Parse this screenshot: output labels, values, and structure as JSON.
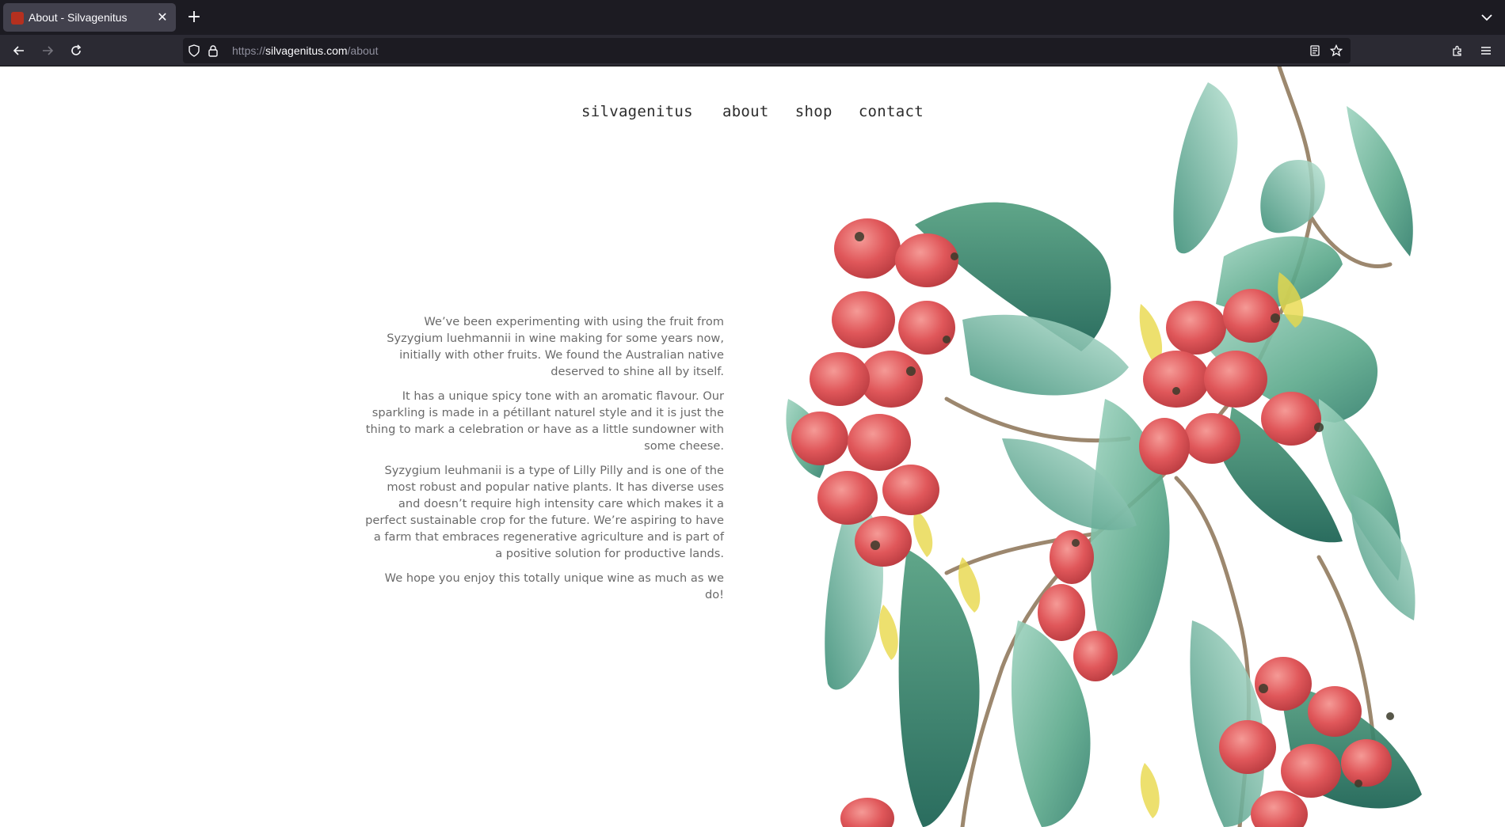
{
  "browser": {
    "tab": {
      "title": "About - Silvagenitus",
      "favicon_color": "#b5301f"
    },
    "url": {
      "scheme": "https://",
      "host": "silvagenitus.com",
      "path": "/about"
    }
  },
  "site": {
    "nav": {
      "brand": "silvagenitus",
      "items": [
        "about",
        "shop",
        "contact"
      ]
    },
    "about": {
      "paragraphs": [
        "We’ve been experimenting with using the fruit from Syzygium luehmannii in wine making for some years now, initially with other fruits. We found the Australian native deserved to shine all by itself.",
        "It has a unique spicy tone with an aromatic flavour. Our sparkling is made in a pétillant naturel style and it is just the thing to mark a celebration or have as a little sundowner with some cheese.",
        "Syzygium leuhmanii is a type of Lilly Pilly and is one of the most robust and popular native plants. It has diverse uses and doesn’t require high intensity care which makes it a perfect sustainable crop for the future. We’re aspiring to have a farm that embraces regenerative agriculture and is part of a positive solution for productive lands.",
        "We hope you enjoy this totally unique wine as much as we do!"
      ]
    },
    "illustration": {
      "subject": "watercolour lilly pilly branch with red berries",
      "colors": {
        "berry": "#e0575a",
        "berry_dark": "#b93b40",
        "leaf": "#5aa88a",
        "leaf_dark": "#2f7d6a",
        "leaf_light": "#9fd4c0",
        "branch": "#8b7355",
        "yellow": "#e8d84a"
      }
    }
  }
}
